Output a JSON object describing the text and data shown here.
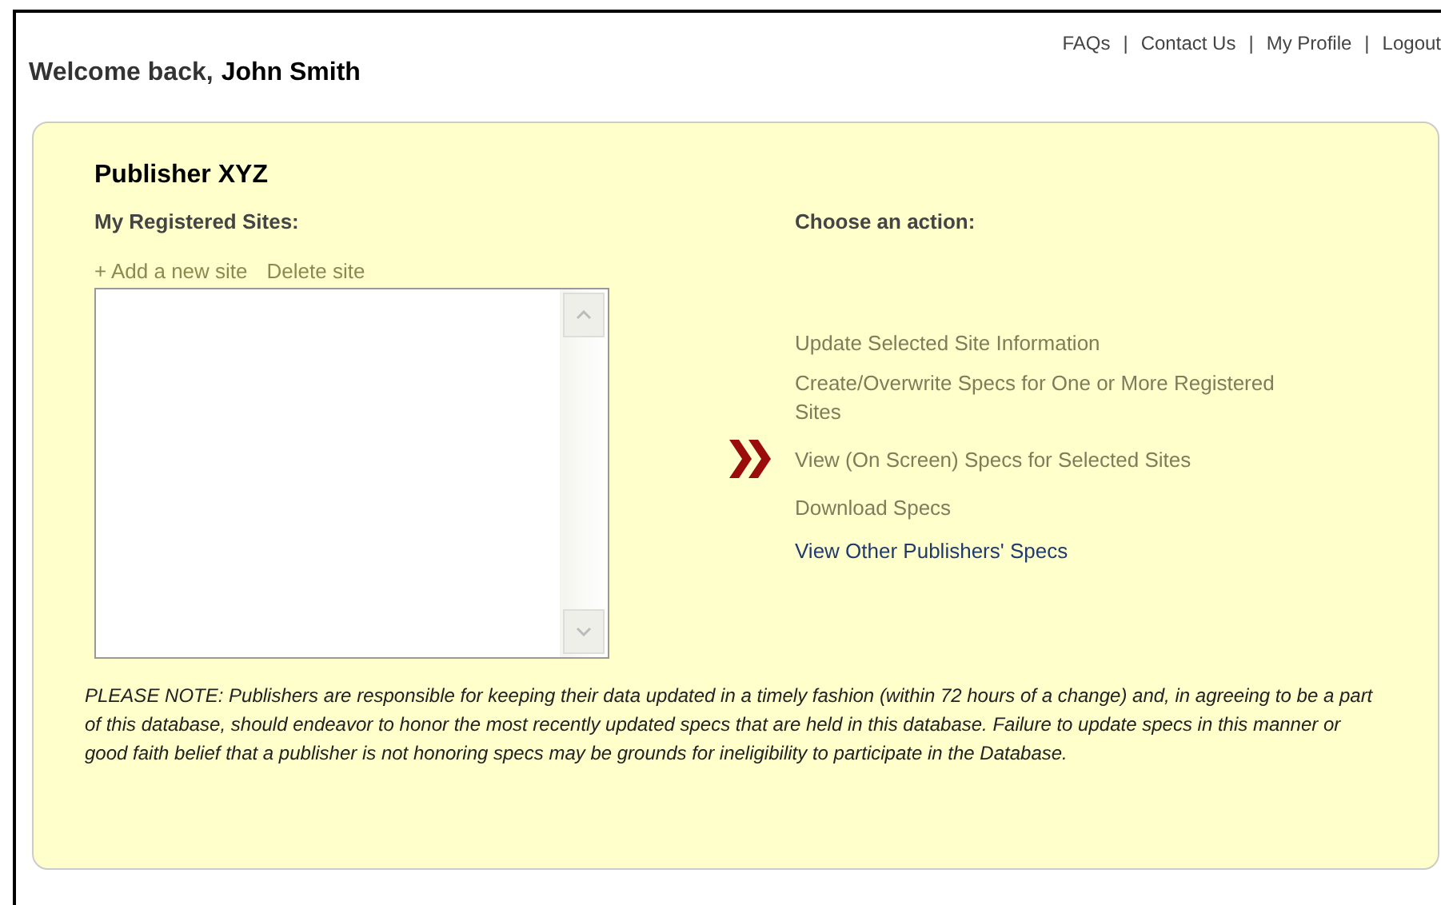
{
  "top_links": [
    {
      "label": "FAQs",
      "separator": "|"
    },
    {
      "label": "Contact Us",
      "separator": "|"
    },
    {
      "label": "My Profile",
      "separator": "|"
    },
    {
      "label": "Logout"
    }
  ],
  "welcome": {
    "greeting": "Welcome back,",
    "name": "John Smith"
  },
  "publisher": "Publisher XYZ",
  "sites": {
    "heading": "My Registered Sites:",
    "links": [
      "+ Add a new site",
      "Delete site"
    ]
  },
  "actions": {
    "heading": "Choose an action:",
    "items": [
      {
        "label": "Update Selected Site Information",
        "disabled": true,
        "pointed": false
      },
      {
        "label": "Create/Overwrite Specs for One or More Registered Sites",
        "disabled": true,
        "pointed": false
      },
      {
        "label": "View (On Screen) Specs for Selected Sites",
        "disabled": true,
        "pointed": true
      },
      {
        "label": "Download Specs",
        "disabled": true,
        "pointed": false
      },
      {
        "label": "View Other Publishers' Specs",
        "disabled": false,
        "pointed": false
      }
    ]
  },
  "note": "PLEASE NOTE: Publishers are responsible for keeping their data updated in a timely fashion (within 72 hours of a change) and, in agreeing to be a part of this database, should endeavor to honor the most recently updated specs that are held in this database. Failure to update specs in this manner or good faith belief that a publisher is not honoring specs may be grounds for ineligibility to participate in the Database."
}
